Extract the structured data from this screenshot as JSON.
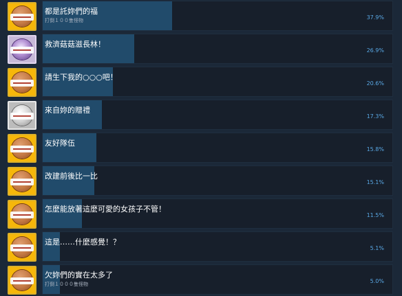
{
  "achievements": [
    {
      "title": "都是託妳們的福",
      "subtitle": "打倒１００隻怪物",
      "percent_label": "37.9%",
      "percent": 37.9,
      "icon": "bronze-medal-icon",
      "style": "bronze"
    },
    {
      "title": "救濟菇菇滋長林！",
      "subtitle": "",
      "percent_label": "26.9%",
      "percent": 26.9,
      "icon": "purple-character-medal-icon",
      "style": "purple"
    },
    {
      "title": "請生下我的○○○吧！",
      "subtitle": "",
      "percent_label": "20.6%",
      "percent": 20.6,
      "icon": "bronze-medal-icon",
      "style": "bronze"
    },
    {
      "title": "來自妳的贈禮",
      "subtitle": "",
      "percent_label": "17.3%",
      "percent": 17.3,
      "icon": "silver-medal-icon",
      "style": "silver"
    },
    {
      "title": "友好隊伍",
      "subtitle": "",
      "percent_label": "15.8%",
      "percent": 15.8,
      "icon": "bronze-medal-icon",
      "style": "bronze"
    },
    {
      "title": "改建前後比一比",
      "subtitle": "",
      "percent_label": "15.1%",
      "percent": 15.1,
      "icon": "bronze-medal-icon",
      "style": "bronze"
    },
    {
      "title": "怎麼能放著這麼可愛的女孩子不管！",
      "subtitle": "",
      "percent_label": "11.5%",
      "percent": 11.5,
      "icon": "bronze-medal-icon",
      "style": "bronze"
    },
    {
      "title": "這是……什麼感覺！？",
      "subtitle": "",
      "percent_label": "5.1%",
      "percent": 5.1,
      "icon": "bronze-medal-icon",
      "style": "bronze"
    },
    {
      "title": "欠妳們的實在太多了",
      "subtitle": "打倒１０００隻怪物",
      "percent_label": "5.0%",
      "percent": 5.0,
      "icon": "bronze-medal-icon",
      "style": "bronze"
    }
  ],
  "colors": {
    "background": "#1b2838",
    "bar_fill": "#214b6b",
    "percent_text": "#5aa9e6",
    "medal_frame": "#f6b70a"
  }
}
